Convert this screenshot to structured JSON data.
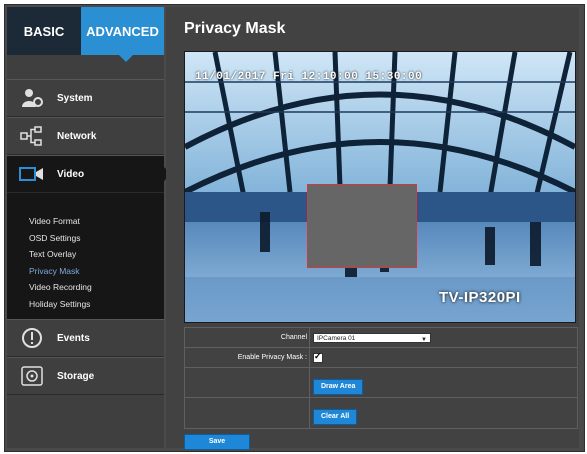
{
  "tabs": {
    "basic": "BASIC",
    "advanced": "ADVANCED"
  },
  "nav": {
    "system": "System",
    "network": "Network",
    "video": "Video",
    "events": "Events",
    "storage": "Storage"
  },
  "video_submenu": [
    "Video Format",
    "OSD Settings",
    "Text Overlay",
    "Privacy Mask",
    "Video Recording",
    "Holiday Settings"
  ],
  "page": {
    "title": "Privacy Mask"
  },
  "camera": {
    "timestamp": "11/01/2017 Fri 12:10:00 15:30:00",
    "model_label": "TV-IP320PI"
  },
  "form": {
    "channel_label": "Channel",
    "channel_value": "IPCamera 01",
    "enable_label": "Enable Privacy Mask :",
    "enable_checked": true,
    "draw_area": "Draw Area",
    "clear_all": "Clear All",
    "save": "Save"
  },
  "colors": {
    "accent": "#2b8fd3",
    "button": "#1f87d8",
    "mask_border": "#cf3b3b"
  }
}
